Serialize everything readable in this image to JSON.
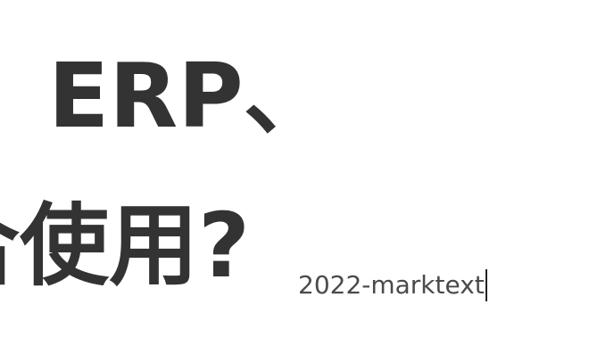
{
  "document": {
    "heading_line_1": "ERP、",
    "heading_line_2": "合使用?"
  },
  "editor": {
    "typed_text": "2022-marktext"
  }
}
